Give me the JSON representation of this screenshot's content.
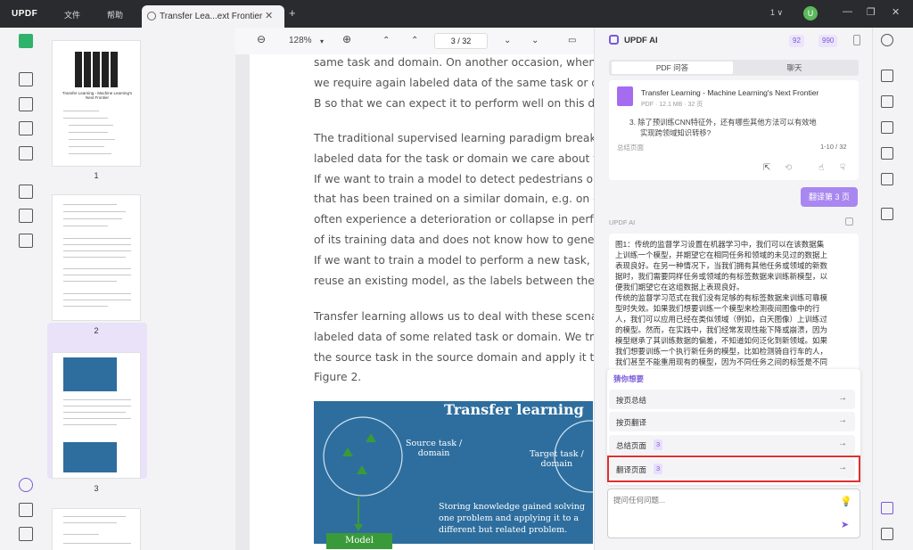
{
  "titlebar": {
    "logo": "UPDF",
    "menu": [
      "文件",
      "帮助"
    ],
    "tab_title": "Transfer Lea...ext Frontier",
    "tab_close": "✕",
    "new_tab": "+",
    "page_indicator": "1 ∨",
    "avatar": "U",
    "win_min": "—",
    "win_max": "❐",
    "win_close": "✕"
  },
  "thumbnails": [
    {
      "page": "1"
    },
    {
      "page": "2"
    },
    {
      "page": "3"
    }
  ],
  "thumb1_title": "Transfer Learning - Machine Learning's Next Frontier",
  "doc_toolbar": {
    "zoom": "128%",
    "current_page": "3",
    "total_pages": "32",
    "page_sep": "/"
  },
  "doc": {
    "para1": [
      "same task and domain. On another occasion, when g",
      "we require again labeled data of the same task or do",
      "B so that we can expect it to perform well on this da"
    ],
    "para2": [
      "The traditional supervised learning paradigm breaks",
      "labeled data for the task or domain we care about to",
      "If we want to train a model to detect pedestrians on",
      "that has been trained on a similar domain, e.g. on da",
      "often experience a deterioration or collapse in perfo",
      "of its training data and does not know how to genera",
      "If we want to train a model to perform a new task, su",
      "reuse an existing model, as the labels between the t"
    ],
    "para3": [
      "Transfer learning allows us to deal with these scenar",
      "labeled data of some related task or domain. We try",
      "the source task in the source domain and apply it to",
      "Figure 2."
    ],
    "figure": {
      "title": "Transfer learning",
      "source_task": [
        "Source task /",
        "domain"
      ],
      "target_task": [
        "Target task /",
        "domain"
      ],
      "storing": [
        "Storing knowledge gained solving",
        "one problem and applying it to a",
        "different but related problem."
      ],
      "model": "Model"
    }
  },
  "ai": {
    "title": "UPDF AI",
    "badge1": "92",
    "badge2": "990",
    "tab_pdf": "PDF 问答",
    "tab_chat": "聊天",
    "doc_name": "Transfer Learning - Machine Learning's Next Frontier",
    "doc_meta": "PDF · 12.1 MB · 32 页",
    "question_lines": [
      "3. 除了预训练CNN特征外，还有哪些其他方法可以有效地",
      "实现跨领域知识转移?"
    ],
    "summary_label": "总结页面",
    "summary_range": "1-10 / 32",
    "detail_button": "翻译第 3 页",
    "ai_label": "UPDF AI",
    "answer_lines": [
      "图1：传统的监督学习设置在机器学习中，我们可以在该数据集",
      "上训练一个模型，并期望它在相同任务和领域的未见过的数据上",
      "表现良好。在另一种情况下，当我们拥有其他任务或领域的新数",
      "据时，我们需要同样任务或领域的有标签数据来训练新模型，以",
      "便我们期望它在这组数据上表现良好。",
      "传统的监督学习范式在我们没有足够的有标签数据来训练可靠模",
      "型时失效。如果我们想要训练一个模型来检测夜间图像中的行",
      "人，我们可以应用已经在类似领域（例如，白天图像）上训练过",
      "的模型。然而，在实践中，我们经常发现性能下降或崩溃，因为",
      "模型继承了其训练数据的偏差，不知道如何泛化到新领域。如果",
      "我们想要训练一个执行新任务的模型，比如检测骑自行车的人，",
      "我们甚至不能重用现有的模型，因为不同任务之间的标签是不同"
    ],
    "suggest_title": "猜你想要",
    "suggestions": [
      {
        "label": "按页总结",
        "tag": ""
      },
      {
        "label": "按页翻译",
        "tag": ""
      },
      {
        "label": "总结页面",
        "tag": "3"
      },
      {
        "label": "翻译页面",
        "tag": "3"
      }
    ],
    "input_placeholder": "提问任何问题..."
  },
  "colors": {
    "accent": "#7a5ad8",
    "highlight": "#e03030",
    "figure_bg": "#2e6e9e"
  }
}
